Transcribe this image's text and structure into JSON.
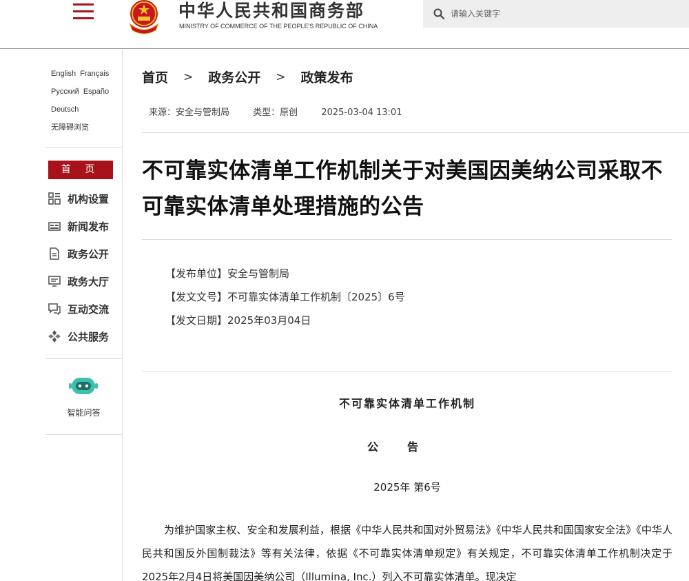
{
  "header": {
    "site_title": "中华人民共和国商务部",
    "site_subtitle": "MINISTRY OF COMMERCE OF THE PEOPLE'S REPUBLIC OF CHINA",
    "search_placeholder": "请输入关键字",
    "brand_color": "#a8131a"
  },
  "left_nav": {
    "languages": [
      "English",
      "Français",
      "Русский",
      "Españo",
      "Deutsch"
    ],
    "accessibility": "无障碍浏览",
    "home_label": "首 页",
    "items": [
      {
        "label": "机构设置",
        "icon": "grid-icon"
      },
      {
        "label": "新闻发布",
        "icon": "newspaper-icon"
      },
      {
        "label": "政务公开",
        "icon": "document-icon"
      },
      {
        "label": "政务大厅",
        "icon": "monitor-icon"
      },
      {
        "label": "互动交流",
        "icon": "chat-icon"
      },
      {
        "label": "公共服务",
        "icon": "service-icon"
      }
    ],
    "assistant_label": "智能问答"
  },
  "breadcrumb": [
    "首页",
    "政务公开",
    "政策发布"
  ],
  "meta": {
    "source": "来源：安全与管制局",
    "type": "类型：原创",
    "datetime": "2025-03-04 13:01"
  },
  "article": {
    "title": "不可靠实体清单工作机制关于对美国因美纳公司采取不可靠实体清单处理措施的公告",
    "info": [
      "【发布单位】安全与管制局",
      "【发文文号】不可靠实体清单工作机制〔2025〕6号",
      "【发文日期】2025年03月04日"
    ],
    "doc_org": "不可靠实体清单工作机制",
    "doc_kind": "公告",
    "doc_no": "2025年 第6号",
    "body": "为维护国家主权、安全和发展利益，根据《中华人民共和国对外贸易法》《中华人民共和国国家安全法》《中华人民共和国反外国制裁法》等有关法律，依据《不可靠实体清单规定》有关规定，不可靠实体清单工作机制决定于2025年2月4日将美国因美纳公司（Illumina, Inc.）列入不可靠实体清单。现决定"
  }
}
